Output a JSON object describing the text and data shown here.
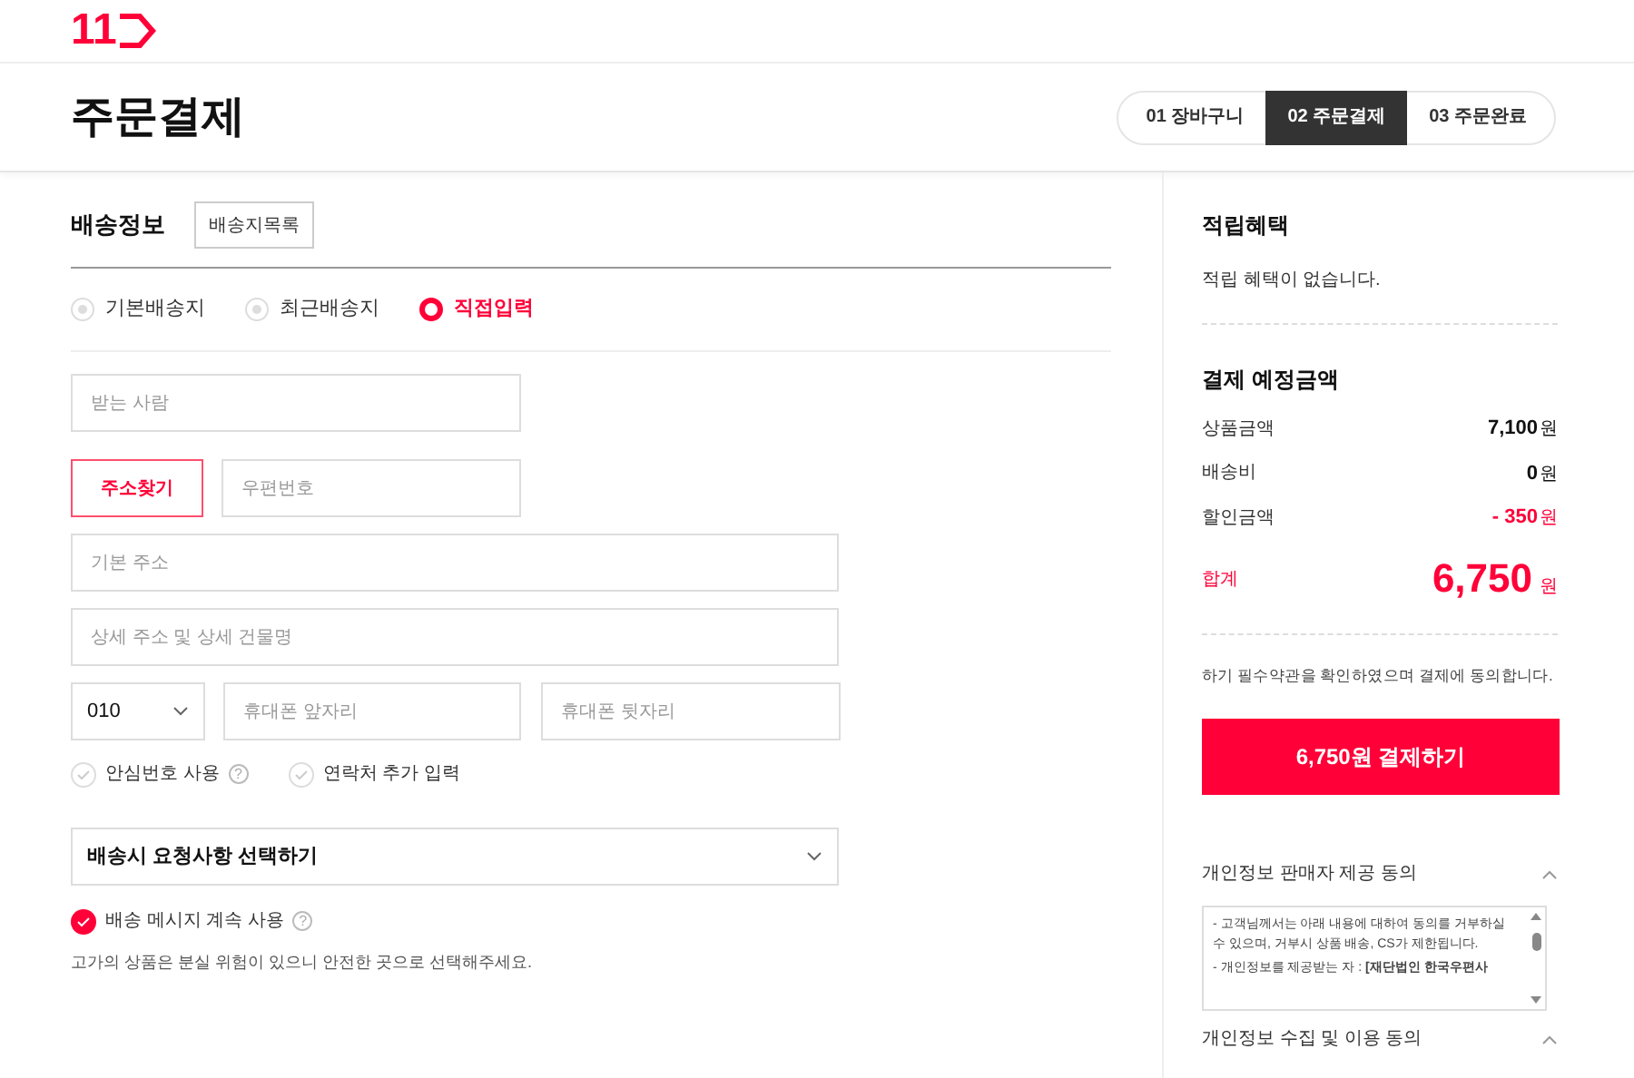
{
  "logo": {
    "text": "11"
  },
  "page_title": "주문결제",
  "steps": [
    {
      "label": "01 장바구니",
      "selected": false
    },
    {
      "label": "02 주문결제",
      "selected": true
    },
    {
      "label": "03 주문완료",
      "selected": false
    }
  ],
  "shipping": {
    "title": "배송정보",
    "list_button": "배송지목록",
    "address_options": [
      {
        "label": "기본배송지",
        "selected": false
      },
      {
        "label": "최근배송지",
        "selected": false
      },
      {
        "label": "직접입력",
        "selected": true
      }
    ],
    "recipient": {
      "placeholder": "받는 사람"
    },
    "find_address_button": "주소찾기",
    "postcode": {
      "placeholder": "우편번호"
    },
    "address": {
      "placeholder": "기본 주소"
    },
    "address_detail": {
      "placeholder": "상세 주소 및 상세 건물명"
    },
    "phone_prefix": "010",
    "phone_mid": {
      "placeholder": "휴대폰 앞자리"
    },
    "phone_last": {
      "placeholder": "휴대폰 뒷자리"
    },
    "phone_options": [
      {
        "label": "안심번호 사용",
        "checked": false,
        "help": "?"
      },
      {
        "label": "연락처 추가 입력",
        "checked": false
      }
    ],
    "request_select": "배송시 요청사항 선택하기",
    "keep_message": {
      "label": "배송 메시지 계속 사용",
      "checked": true,
      "help": "?"
    },
    "notice": "고가의 상품은 분실 위험이 있으니 안전한 곳으로 선택해주세요."
  },
  "benefit": {
    "title": "적립혜택",
    "text": "적립 혜택이 없습니다."
  },
  "payment": {
    "title": "결제 예정금액",
    "rows": [
      {
        "label": "상품금액",
        "amount": "7,100",
        "unit": "원",
        "kind": "normal"
      },
      {
        "label": "배송비",
        "amount": "0",
        "unit": "원",
        "kind": "normal"
      },
      {
        "label": "할인금액",
        "amount": "- 350",
        "unit": "원",
        "kind": "discount"
      }
    ],
    "total": {
      "label": "합계",
      "amount": "6,750",
      "unit": "원"
    },
    "agree_text": "하기 필수약관을 확인하였으며 결제에 동의합니다.",
    "pay_button": "6,750원 결제하기"
  },
  "terms": [
    {
      "title": "개인정보 판매자 제공 동의",
      "expanded": true,
      "lines": [
        "- 고객님께서는 아래 내용에 대하여 동의를 거부하실 수 있으며, 거부시 상품 배송, CS가 제한됩니다.",
        "- 개인정보를 제공받는 자 : **[재단법인 한국우편사**"
      ]
    },
    {
      "title": "개인정보 수집 및 이용 동의",
      "expanded": true
    }
  ]
}
